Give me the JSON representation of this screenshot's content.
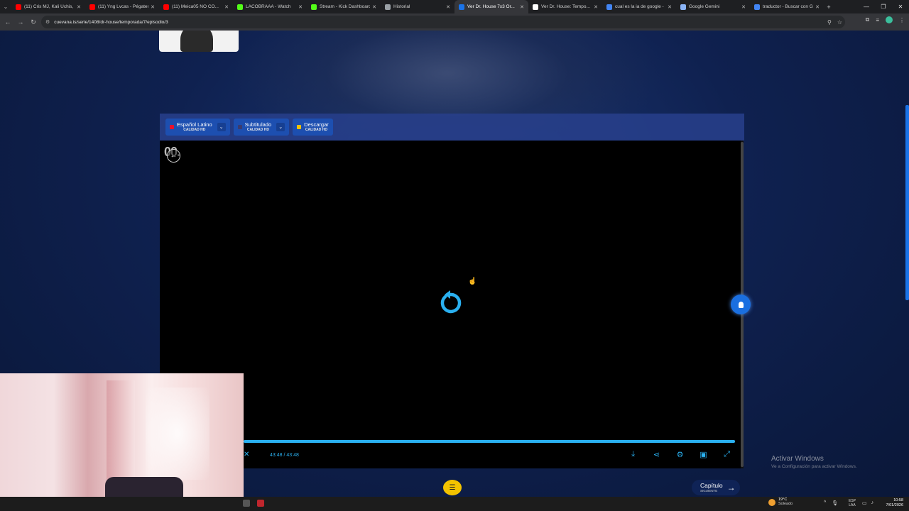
{
  "browser": {
    "tabs": [
      {
        "title": "(11) Cris MJ, Kali Uchis, ...",
        "favicon_color": "#ff0000",
        "active": false
      },
      {
        "title": "(11) Yng Lvcas - Pégatem...",
        "favicon_color": "#ff0000",
        "active": false
      },
      {
        "title": "(11) Meica05 NO CO...",
        "favicon_color": "#ff0000",
        "active": false
      },
      {
        "title": "LACOBRAAA - Watch",
        "favicon_color": "#53fc18",
        "active": false
      },
      {
        "title": "Stream - Kick Dashboard",
        "favicon_color": "#53fc18",
        "active": false
      },
      {
        "title": "Historial",
        "favicon_color": "#9aa0a6",
        "active": false
      },
      {
        "title": "Ver Dr. House 7x3 Or...",
        "favicon_color": "#1a73e8",
        "active": true
      },
      {
        "title": "Ver Dr. House: Tempo...",
        "favicon_color": "#ffffff",
        "active": false
      },
      {
        "title": "cual es la ia de google - ...",
        "favicon_color": "#4285f4",
        "active": false
      },
      {
        "title": "Google Gemini",
        "favicon_color": "#8ab4f8",
        "active": false
      },
      {
        "title": "traductor - Buscar con Go...",
        "favicon_color": "#4285f4",
        "active": false
      }
    ],
    "url": "cuevana.is/serie/1408/dr-house/temporada/7/episodio/3"
  },
  "player": {
    "audio_options": [
      {
        "name": "Español Latino",
        "quality": "CALIDAD HD",
        "flag_color": "#e8112d",
        "has_dropdown": true
      },
      {
        "name": "Subtitulado",
        "quality": "CALIDAD HD",
        "flag_color": "#3c3b6e",
        "has_dropdown": true
      },
      {
        "name": "Descargar",
        "quality": "CALIDAD HD",
        "flag_color": "#f2c200",
        "has_dropdown": false
      }
    ],
    "logo_text": "00.",
    "current_time": "43:48",
    "duration": "43:48",
    "progress_fraction": 1.0,
    "accent_color": "#2ab0f0"
  },
  "page": {
    "next_label": "Capítulo",
    "next_sub": "SIGUIENTE"
  },
  "os": {
    "activate_title": "Activar Windows",
    "activate_sub": "Ve a Configuración para activar Windows.",
    "weather_temp": "19°C",
    "weather_cond": "Soleado",
    "lang_line1": "ESP",
    "lang_line2": "LAA",
    "time": "10:58",
    "date": "7/01/2026"
  }
}
